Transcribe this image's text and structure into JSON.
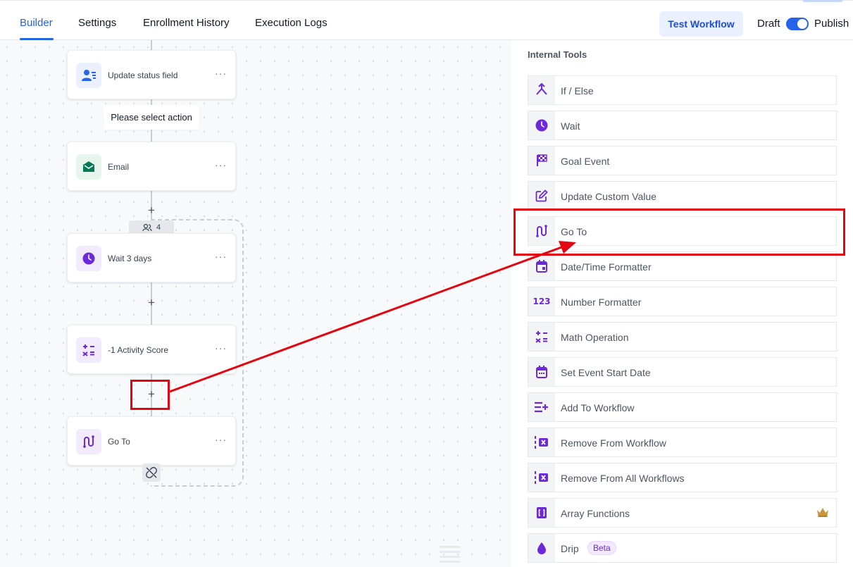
{
  "nav": {
    "tabs": [
      {
        "label": "Builder",
        "active": true
      },
      {
        "label": "Settings"
      },
      {
        "label": "Enrollment History"
      },
      {
        "label": "Execution Logs"
      }
    ],
    "test_button": "Test Workflow",
    "draft_label": "Draft",
    "publish_label": "Publish",
    "publish_toggle_on": true
  },
  "canvas": {
    "tooltip": "Please select action",
    "enrolled_count": "4",
    "nodes": [
      {
        "title": "Update status field",
        "icon": "contact-update-icon"
      },
      {
        "title": "Email",
        "icon": "email-icon"
      },
      {
        "title": "Wait 3 days",
        "icon": "clock-icon"
      },
      {
        "title": "-1 Activity Score",
        "icon": "math-icon"
      },
      {
        "title": "Go To",
        "icon": "goto-icon"
      }
    ],
    "more_label": "···",
    "plus_label": "+"
  },
  "panel": {
    "title": "Internal Tools",
    "tools": [
      {
        "label": "If / Else",
        "icon": "branch-icon"
      },
      {
        "label": "Wait",
        "icon": "clock-icon"
      },
      {
        "label": "Goal Event",
        "icon": "checkered-flag-icon"
      },
      {
        "label": "Update Custom Value",
        "icon": "edit-icon"
      },
      {
        "label": "Go To",
        "icon": "goto-icon"
      },
      {
        "label": "Date/Time Formatter",
        "icon": "calendar-icon"
      },
      {
        "label": "Number Formatter",
        "icon": "number-icon"
      },
      {
        "label": "Math Operation",
        "icon": "math-icon"
      },
      {
        "label": "Set Event Start Date",
        "icon": "calendar-icon"
      },
      {
        "label": "Add To Workflow",
        "icon": "list-add-icon"
      },
      {
        "label": "Remove From Workflow",
        "icon": "list-remove-icon"
      },
      {
        "label": "Remove From All Workflows",
        "icon": "list-remove-icon"
      },
      {
        "label": "Array Functions",
        "icon": "brackets-icon",
        "premium": true
      },
      {
        "label": "Drip",
        "icon": "drop-icon",
        "badge": "Beta"
      }
    ]
  },
  "colors": {
    "accent": "#2563eb",
    "tool_icon": "#6d28d9",
    "annotation": "#e3050f",
    "email_icon": "#047857"
  }
}
